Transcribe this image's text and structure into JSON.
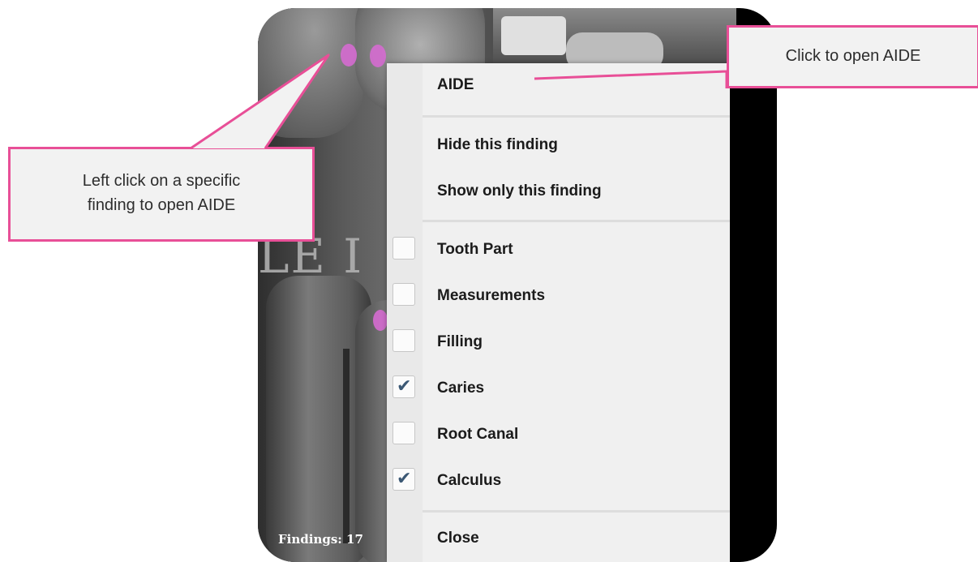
{
  "xray": {
    "watermark_text": "LE I",
    "findings_label": "Findings: 17"
  },
  "context_menu": {
    "aide_label": "AIDE",
    "hide_label": "Hide this finding",
    "show_only_label": "Show only this finding",
    "options": [
      {
        "label": "Tooth Part",
        "checked": false
      },
      {
        "label": "Measurements",
        "checked": false
      },
      {
        "label": "Filling",
        "checked": false
      },
      {
        "label": "Caries",
        "checked": true
      },
      {
        "label": "Root Canal",
        "checked": false
      },
      {
        "label": "Calculus",
        "checked": true
      }
    ],
    "close_label": "Close",
    "check_glyph": "✔"
  },
  "callouts": {
    "aide": "Click to open AIDE",
    "left_line1": "Left click on a specific",
    "left_line2": "finding to open AIDE"
  },
  "colors": {
    "callout_border": "#e84f97",
    "finding_marker": "#d56bd0",
    "checkmark": "#3b5874"
  }
}
